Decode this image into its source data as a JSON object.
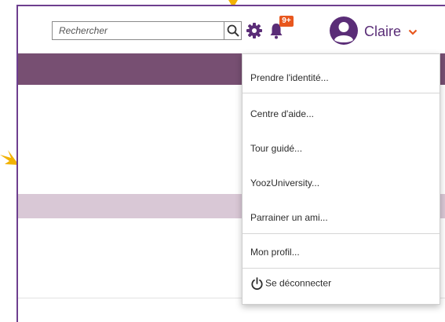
{
  "header": {
    "search": {
      "placeholder": "Rechercher",
      "value": ""
    },
    "notifications": {
      "badge": "9+"
    },
    "user": {
      "name": "Claire"
    }
  },
  "user_menu": {
    "items": [
      {
        "label": "Prendre l'identité..."
      },
      {
        "label": "Centre d'aide..."
      },
      {
        "label": "Tour guidé..."
      },
      {
        "label": "YoozUniversity..."
      },
      {
        "label": "Parrainer un ami..."
      },
      {
        "label": "Mon profil..."
      },
      {
        "label": "Se déconnecter"
      }
    ]
  },
  "colors": {
    "brand_purple": "#6e3f8f",
    "header_band": "#774f72",
    "light_band": "#d9c8d6",
    "badge": "#e8571e",
    "annotation_arrow": "#f2b203"
  },
  "icons": [
    "search-icon",
    "gear-icon",
    "bell-icon",
    "user-avatar-icon",
    "chevron-down-icon",
    "power-icon"
  ]
}
